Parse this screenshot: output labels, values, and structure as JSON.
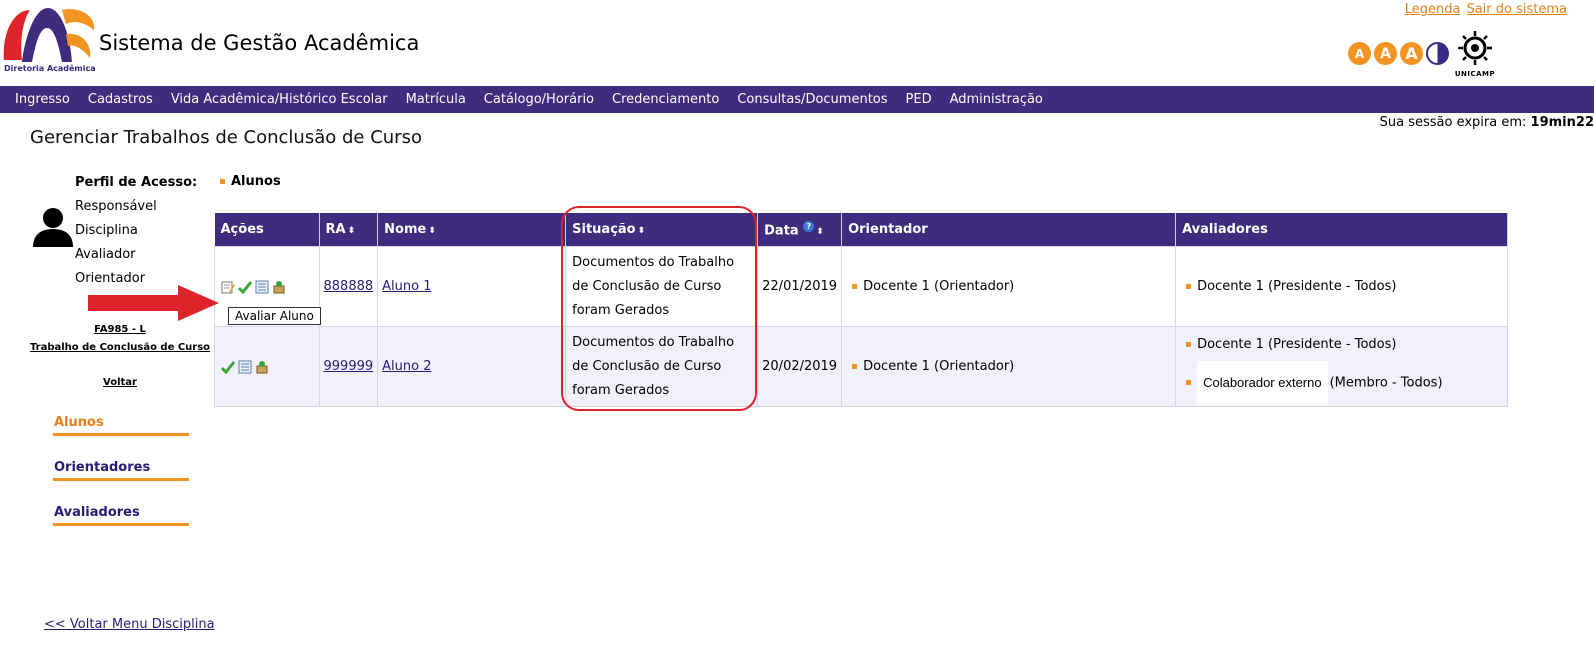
{
  "header": {
    "logo_sub": "Diretoria Acadêmica",
    "app_title": "Sistema de Gestão Acadêmica",
    "link_legenda": "Legenda",
    "link_sair": "Sair do sistema",
    "font_buttons": [
      "A",
      "A",
      "A"
    ],
    "unicamp_label": "UNICAMP"
  },
  "nav": [
    "Ingresso",
    "Cadastros",
    "Vida Acadêmica/Histórico Escolar",
    "Matrícula",
    "Catálogo/Horário",
    "Credenciamento",
    "Consultas/Documentos",
    "PED",
    "Administração"
  ],
  "session": {
    "label": "Sua sessão expira em:",
    "time": "19min22"
  },
  "page_title": "Gerenciar Trabalhos de Conclusão de Curso",
  "sidebar": {
    "perfil_label": "Perfil de Acesso:",
    "perfis": [
      "Responsável",
      "Disciplina",
      "Avaliador",
      "Orientador"
    ],
    "disc_code": "FA985 - L",
    "disc_name": "Trabalho de Conclusão de Curso",
    "voltar": "Voltar",
    "menu": [
      {
        "label": "Alunos",
        "active": true
      },
      {
        "label": "Orientadores",
        "active": false
      },
      {
        "label": "Avaliadores",
        "active": false
      }
    ],
    "back_menu": "<< Voltar Menu Disciplina"
  },
  "section_label": "Alunos",
  "tooltip": "Avaliar Aluno",
  "table": {
    "headers": {
      "acoes": "Ações",
      "ra": "RA",
      "nome": "Nome",
      "situacao": "Situação",
      "data": "Data",
      "orientador": "Orientador",
      "avaliadores": "Avaliadores"
    },
    "sort_glyph": "⬍",
    "help_glyph": "?",
    "rows": [
      {
        "ra": "888888",
        "nome": "Aluno 1",
        "situacao": "Documentos do Trabalho de Conclusão de Curso foram Gerados",
        "data": "22/01/2019",
        "orientador": "Docente 1 (Orientador)",
        "avaliador1": "Docente 1 (Presidente - Todos)"
      },
      {
        "ra": "999999",
        "nome": "Aluno 2",
        "situacao": "Documentos do Trabalho de Conclusão de Curso foram Gerados",
        "data": "20/02/2019",
        "orientador": "Docente 1 (Orientador)",
        "avaliador1": "Docente 1 (Presidente - Todos)",
        "avaliador2_chip": "Colaborador externo",
        "avaliador2_role": "(Membro - Todos)"
      }
    ]
  },
  "colors": {
    "nav_bg": "#3e2c7e",
    "accent": "#f39322",
    "link": "#2a1a78",
    "highlight": "#e0242b"
  }
}
